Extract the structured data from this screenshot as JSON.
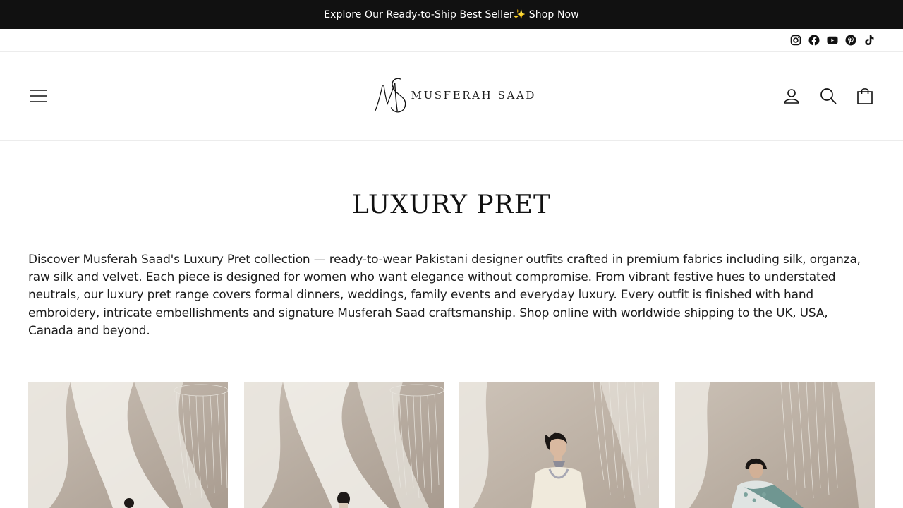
{
  "announcement": {
    "text": "Explore Our Ready-to-Ship Best Seller✨ Shop Now"
  },
  "social": {
    "items": [
      "instagram-icon",
      "facebook-icon",
      "youtube-icon",
      "pinterest-icon",
      "tiktok-icon"
    ]
  },
  "header": {
    "brand": "MUSFERAH SAAD",
    "icons": [
      "menu-icon",
      "account-icon",
      "search-icon",
      "cart-icon"
    ]
  },
  "collection": {
    "title": "LUXURY PRET",
    "description": "Discover Musferah Saad's Luxury Pret collection — ready-to-wear Pakistani designer outfits crafted in premium fabrics including silk, organza, raw silk and velvet. Each piece is designed for women who want elegance without compromise. From vibrant festive hues to understated neutrals, our luxury pret range covers formal dinners, weddings, family events and everyday luxury. Every outfit is finished with hand embroidery, intricate embellishments and signature Musferah Saad craftsmanship. Shop online with worldwide shipping to the UK, USA, Canada and beyond."
  },
  "colors": {
    "announcement_bg": "#111111",
    "text": "#1c1c1c",
    "photo_backdrop": "#b9ada2",
    "drape": "#f2f0ea"
  }
}
